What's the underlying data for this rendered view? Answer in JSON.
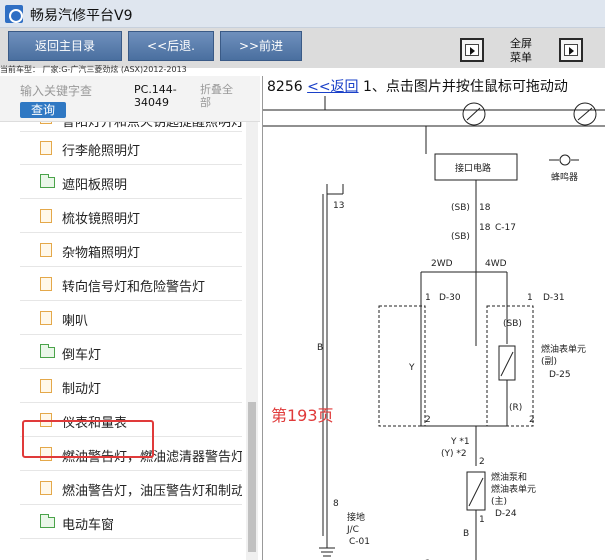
{
  "window": {
    "title": "畅易汽修平台V9"
  },
  "toolbar": {
    "main_menu": "返回主目录",
    "back": "<<后退.",
    "forward": ">>前进",
    "fullscreen": "全屏",
    "menu": "菜单"
  },
  "car_info": "当前车型： 厂家:G-广汽三菱劲炫 (ASX)2012-2013",
  "search": {
    "placeholder": "输入关键字查",
    "button": "查询",
    "code": "PC.144-34049",
    "fold_all": "折叠全部"
  },
  "tree": {
    "partial_item": "鲁阳灯开和点火钥匙提醒照明灯",
    "items": [
      {
        "label": "行李舱照明灯",
        "icon": "document-icon"
      },
      {
        "label": "遮阳板照明",
        "icon": "folder-icon"
      },
      {
        "label": "梳妆镜照明灯",
        "icon": "document-icon"
      },
      {
        "label": "杂物箱照明灯",
        "icon": "document-icon"
      },
      {
        "label": "转向信号灯和危险警告灯",
        "icon": "document-icon"
      },
      {
        "label": "喇叭",
        "icon": "document-icon"
      },
      {
        "label": "倒车灯",
        "icon": "folder-icon"
      },
      {
        "label": "制动灯",
        "icon": "document-icon"
      },
      {
        "label": "仪表和量表",
        "icon": "document-icon"
      },
      {
        "label": "燃油警告灯，燃油滤清器警告灯",
        "icon": "document-icon"
      },
      {
        "label": "燃油警告灯，油压警告灯和制动警告灯",
        "icon": "document-icon"
      },
      {
        "label": "电动车窗",
        "icon": "folder-icon"
      }
    ]
  },
  "viewer": {
    "page_no": "8256",
    "back_link": "<<返回",
    "instruction": "1、点击图片并按住鼠标可拖动动",
    "page_label": "第193页"
  },
  "diagram": {
    "interface_circuit": "接口电路",
    "buzzer": "蜂鸣器",
    "fuel_gauge_sub": "燃油表单元",
    "sub": "(副)",
    "fuel_pump_main": "燃油泵和",
    "fuel_gauge_main": "燃油表单元",
    "main": "(主)",
    "ground": "接地",
    "jc": "J/C",
    "labels": {
      "sb1": "(SB)",
      "n18": "18",
      "n18c": "18",
      "c17": "C-17",
      "sb2": "(SB)",
      "wd2": "2WD",
      "wd4": "4WD",
      "n1a": "1",
      "d30": "D-30",
      "n1b": "1",
      "d31": "D-31",
      "y": "Y",
      "sb3": "(SB)",
      "d25": "D-25",
      "n2a": "2",
      "r": "(R)",
      "n2b": "2",
      "n2c": "2",
      "b": "B",
      "n13": "13",
      "n8": "8",
      "c01": "C-01",
      "y1": "Y *1",
      "y2": "(Y) *2",
      "n2d": "2",
      "n1c": "1",
      "d24": "D-24",
      "b2": "B"
    }
  },
  "colors": {
    "accent": "#2f78c3",
    "highlight": "#e03a3a",
    "link": "#1a40c8"
  }
}
